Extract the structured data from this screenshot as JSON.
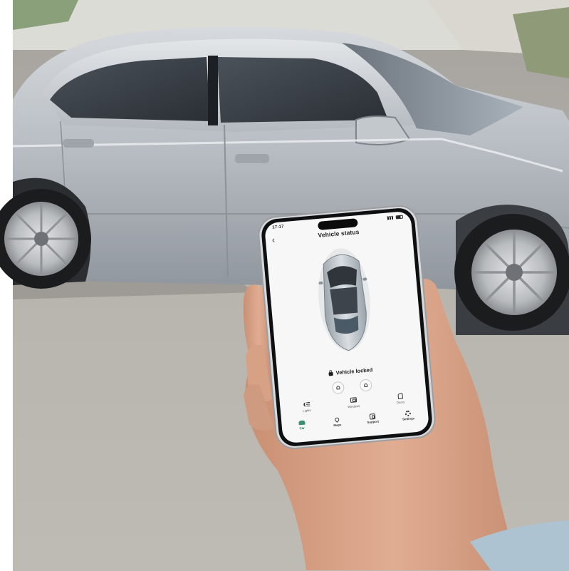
{
  "app": {
    "status_time": "17:17",
    "title": "Vehicle status",
    "lock_status": "Vehicle locked",
    "features": [
      {
        "label": "Lights",
        "icon": "headlight-icon"
      },
      {
        "label": "Windows",
        "icon": "window-icon"
      },
      {
        "label": "Doors",
        "icon": "door-icon"
      }
    ],
    "tabs": [
      {
        "label": "Car",
        "icon": "car-icon",
        "active": true
      },
      {
        "label": "Maps",
        "icon": "map-pin-icon"
      },
      {
        "label": "Support",
        "icon": "support-icon"
      },
      {
        "label": "Settings",
        "icon": "gear-icon"
      }
    ],
    "accent_color": "#3c8f6f"
  },
  "colors": {
    "car_silver": "#b9bec4",
    "pavement": "#b6b2ac",
    "skin": "#d9a488"
  }
}
